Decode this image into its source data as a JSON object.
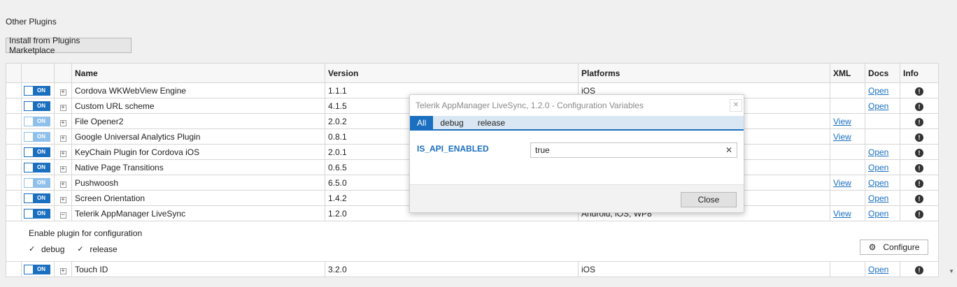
{
  "section_title": "Other Plugins",
  "marketplace_button": "Install from Plugins Marketplace",
  "columns": {
    "name": "Name",
    "version": "Version",
    "platforms": "Platforms",
    "xml": "XML",
    "docs": "Docs",
    "info": "Info"
  },
  "toggle_label": "ON",
  "plugins": [
    {
      "name": "Cordova WKWebView Engine",
      "version": "1.1.1",
      "platforms": "iOS",
      "xml": "",
      "docs": "Open",
      "enabled": true
    },
    {
      "name": "Custom URL scheme",
      "version": "4.1.5",
      "platforms": "",
      "xml": "",
      "docs": "Open",
      "enabled": true
    },
    {
      "name": "File Opener2",
      "version": "2.0.2",
      "platforms": "",
      "xml": "View",
      "docs": "",
      "enabled": false
    },
    {
      "name": "Google Universal Analytics Plugin",
      "version": "0.8.1",
      "platforms": "",
      "xml": "View",
      "docs": "",
      "enabled": false
    },
    {
      "name": "KeyChain Plugin for Cordova iOS",
      "version": "2.0.1",
      "platforms": "",
      "xml": "",
      "docs": "Open",
      "enabled": true
    },
    {
      "name": "Native Page Transitions",
      "version": "0.6.5",
      "platforms": "",
      "xml": "",
      "docs": "Open",
      "enabled": true
    },
    {
      "name": "Pushwoosh",
      "version": "6.5.0",
      "platforms": "",
      "xml": "View",
      "docs": "Open",
      "enabled": false
    },
    {
      "name": "Screen Orientation",
      "version": "1.4.2",
      "platforms": "",
      "xml": "",
      "docs": "Open",
      "enabled": true
    },
    {
      "name": "Telerik AppManager LiveSync",
      "version": "1.2.0",
      "platforms": "Android, iOS, WP8",
      "xml": "View",
      "docs": "Open",
      "enabled": true
    }
  ],
  "config_panel": {
    "title": "Enable plugin for configuration",
    "options": [
      "debug",
      "release"
    ],
    "configure_button": "Configure"
  },
  "last_plugin": {
    "name": "Touch ID",
    "version": "3.2.0",
    "platforms": "iOS",
    "xml": "",
    "docs": "Open",
    "enabled": true
  },
  "dialog": {
    "title": "Telerik AppManager LiveSync, 1.2.0 - Configuration Variables",
    "tabs": [
      "All",
      "debug",
      "release"
    ],
    "active_tab": "All",
    "variable_name": "IS_API_ENABLED",
    "variable_value": "true",
    "close_button": "Close"
  },
  "colors": {
    "accent": "#1a6fc0",
    "toggle_dim": "#8fc0ec"
  }
}
